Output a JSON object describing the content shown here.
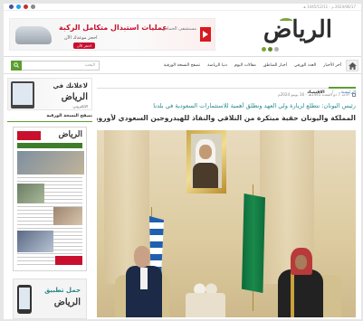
{
  "topbar": {
    "date": "2024/06/17 م - 1445/12/11 هـ"
  },
  "ad": {
    "title": "عمليات استبدال متكامل الركبة",
    "subtitle": "احجز موعدك الآن",
    "cta": "احجز الآن",
    "brand": "مستشفى الحمادي"
  },
  "header": {
    "logo_text": "الرياض"
  },
  "nav": {
    "items": [
      {
        "label": "آخر الأخبار"
      },
      {
        "label": "العدد الورقي"
      },
      {
        "label": "أخبار المناطق"
      },
      {
        "label": "مقالات اليوم"
      },
      {
        "label": "دنيا الرياضة"
      },
      {
        "label": "تصفح النسخة الورقية"
      }
    ],
    "search_placeholder": "البحث"
  },
  "article": {
    "breadcrumb": {
      "home": "الرئيسية",
      "section": "الاقتصاد"
    },
    "meta": "الاحد 7 ذو القعدة 1445هـ - 16 يونيو 2024م",
    "kicker": "رئيس اليونان: نتطلع لزيارة ولي العهد ونطلق أهمية للاستثمارات السعودية في بلدنا",
    "headline": "المملكة واليونان حقبة مبتكرة من التلاقي والنفاذ للهيدروجين السعودي لأوروبا"
  },
  "sidebar": {
    "ad": {
      "line1": "لاعلانك في",
      "line2": "الرياض",
      "line3": "الإلكتروني"
    },
    "print_title": "تصفح النسخة الورقية",
    "newspaper_logo": "الرياض",
    "app": {
      "line1": "حمل تطبيق",
      "line2": "الرياض"
    }
  }
}
